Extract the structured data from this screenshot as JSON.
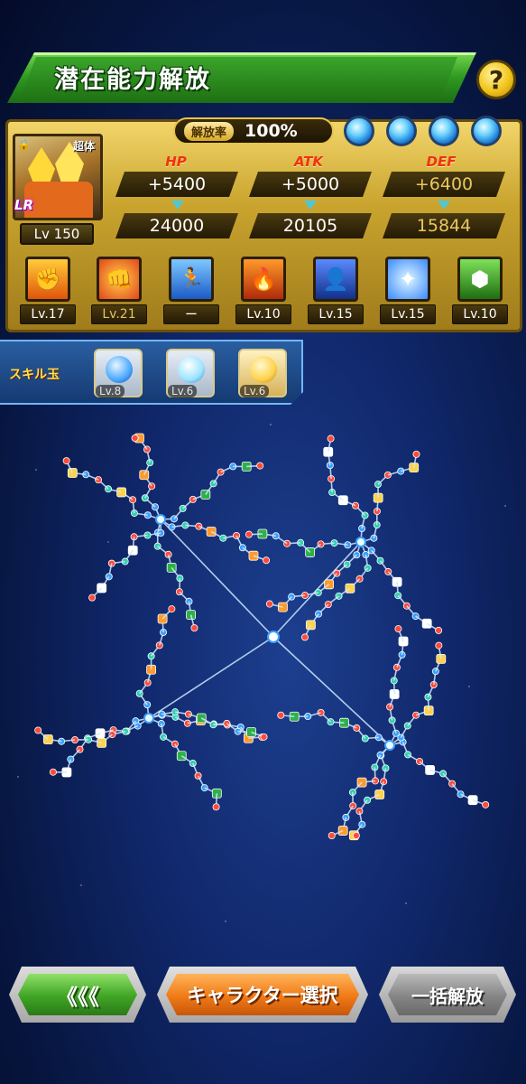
{
  "title": "潜在能力解放",
  "help_icon": "?",
  "character": {
    "level": "Lv 150",
    "rarity": "LR",
    "type_tag": "超体",
    "release_rate_label": "解放率",
    "release_rate": "100%",
    "stats": [
      {
        "label": "HP",
        "bonus": "+5400",
        "total": "24000"
      },
      {
        "label": "ATK",
        "bonus": "+5000",
        "total": "20105"
      },
      {
        "label": "DEF",
        "bonus": "+6400",
        "total": "15844"
      }
    ],
    "skills": [
      {
        "icon": "fist-icon",
        "level": "Lv.17"
      },
      {
        "icon": "punch-icon",
        "level": "Lv.21"
      },
      {
        "icon": "runner-icon",
        "level": "ー"
      },
      {
        "icon": "goku-silhouette-icon",
        "level": "Lv.10"
      },
      {
        "icon": "goku-kid-icon",
        "level": "Lv.15"
      },
      {
        "icon": "ki-blast-icon",
        "level": "Lv.15"
      },
      {
        "icon": "shield-icon",
        "level": "Lv.10"
      }
    ]
  },
  "skill_orbs": {
    "label": "スキル玉",
    "items": [
      {
        "level": "Lv.8",
        "color": "#4aa8ff"
      },
      {
        "level": "Lv.6",
        "color": "#9be4ff"
      },
      {
        "level": "Lv.6",
        "color": "#ffd24a"
      }
    ]
  },
  "buttons": {
    "back": "《《《",
    "select": "キャラクター選択",
    "bulk": "一括解放"
  },
  "colors": {
    "hp": "#f0330f",
    "node_blue": "#3aa0ff",
    "node_teal": "#2fd0b0",
    "node_red": "#ff4a3a",
    "link": "#cfe9ff"
  }
}
